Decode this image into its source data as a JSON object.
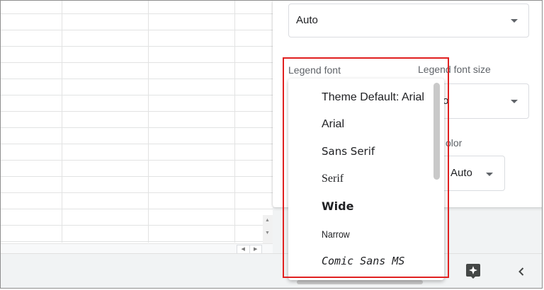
{
  "panel": {
    "position_select": {
      "value": "Auto"
    },
    "legend_font": {
      "label": "Legend font"
    },
    "legend_font_size": {
      "label": "Legend font size",
      "value_partial": "o"
    },
    "legend_color": {
      "label_partial": "olor",
      "value": "Auto"
    }
  },
  "font_dropdown": {
    "options": [
      {
        "label": "Theme Default: Arial",
        "family": "Arial"
      },
      {
        "label": "Arial",
        "family": "Arial"
      },
      {
        "label": "Sans Serif",
        "family": "Sans Serif"
      },
      {
        "label": "Serif",
        "family": "Serif"
      },
      {
        "label": "Wide",
        "family": "Wide"
      },
      {
        "label": "Narrow",
        "family": "Narrow"
      },
      {
        "label": "Comic Sans MS",
        "family": "Comic Sans MS"
      }
    ]
  },
  "icons": {
    "explore": "explore-icon",
    "collapse": "chevron-left-icon",
    "caret": "caret-down-icon"
  },
  "colors": {
    "highlight": "#e02020",
    "bottom_bar": "#f1f3f4",
    "text": "#202124",
    "label": "#5f6368"
  }
}
